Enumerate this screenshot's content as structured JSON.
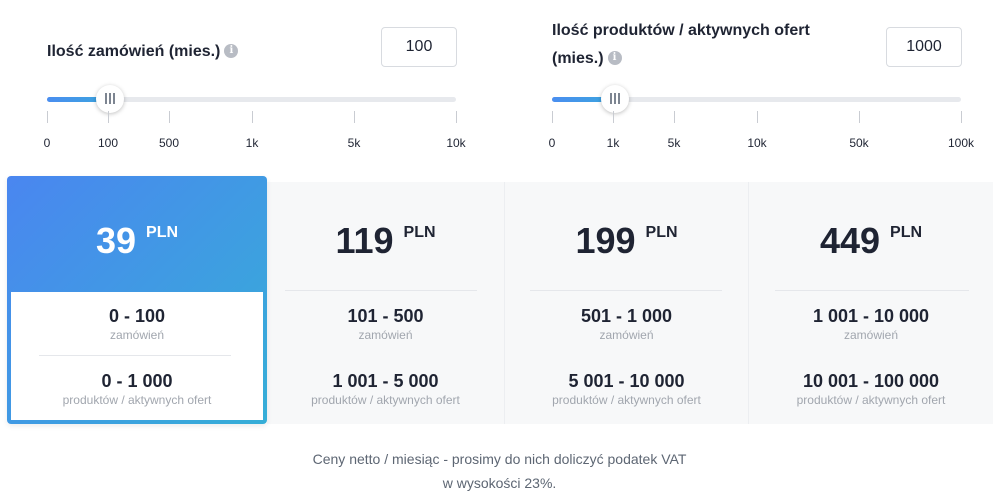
{
  "sliders": [
    {
      "title": "Ilość zamówień (mies.)",
      "value": "100",
      "ticks": [
        "0",
        "100",
        "500",
        "1k",
        "5k",
        "10k"
      ]
    },
    {
      "title_line1": "Ilość produktów / aktywnych ofert",
      "title_line2": "(mies.)",
      "value": "1000",
      "ticks": [
        "0",
        "1k",
        "5k",
        "10k",
        "50k",
        "100k"
      ]
    }
  ],
  "info_icon_glyph": "i",
  "plans": [
    {
      "price": "39",
      "currency": "PLN",
      "orders_range": "0 - 100",
      "orders_label": "zamówień",
      "products_range": "0 - 1 000",
      "products_label": "produktów / aktywnych ofert",
      "selected": true
    },
    {
      "price": "119",
      "currency": "PLN",
      "orders_range": "101 - 500",
      "orders_label": "zamówień",
      "products_range": "1 001 - 5 000",
      "products_label": "produktów / aktywnych ofert"
    },
    {
      "price": "199",
      "currency": "PLN",
      "orders_range": "501 - 1 000",
      "orders_label": "zamówień",
      "products_range": "5 001 - 10 000",
      "products_label": "produktów / aktywnych ofert"
    },
    {
      "price": "449",
      "currency": "PLN",
      "orders_range": "1 001 - 10 000",
      "orders_label": "zamówień",
      "products_range": "10 001 - 100 000",
      "products_label": "produktów / aktywnych ofert"
    }
  ],
  "footnote": {
    "line1": "Ceny netto / miesiąc - prosimy do nich doliczyć podatek VAT",
    "line2": "w wysokości 23%."
  },
  "colors": {
    "accent_start": "#4a86f0",
    "accent_end": "#36aed7",
    "card_bg": "#f7f8f9"
  }
}
